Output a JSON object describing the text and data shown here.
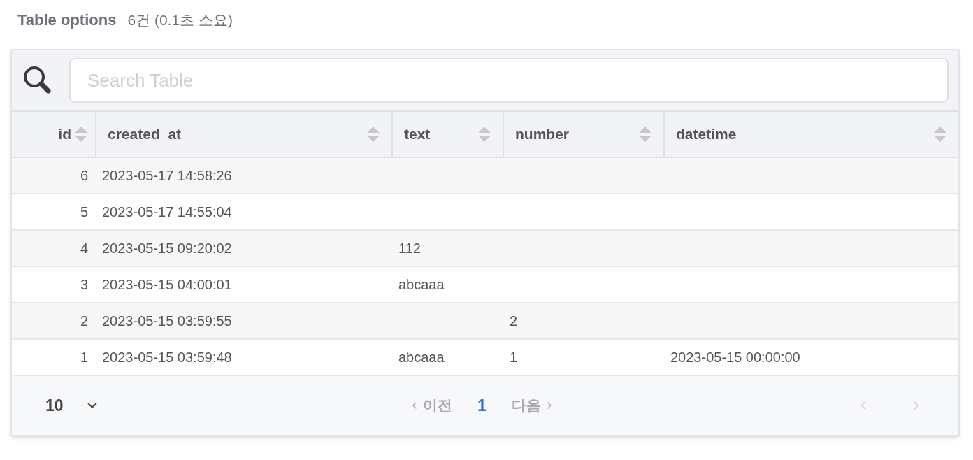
{
  "header": {
    "title": "Table options",
    "summary": "6건 (0.1초 소요)"
  },
  "search": {
    "placeholder": "Search Table"
  },
  "table": {
    "columns": [
      {
        "label": "id"
      },
      {
        "label": "created_at"
      },
      {
        "label": "text"
      },
      {
        "label": "number"
      },
      {
        "label": "datetime"
      }
    ],
    "rows": [
      {
        "cells": [
          "6",
          "2023-05-17 14:58:26",
          null,
          null,
          null
        ]
      },
      {
        "cells": [
          "5",
          "2023-05-17 14:55:04",
          null,
          null,
          null
        ]
      },
      {
        "cells": [
          "4",
          "2023-05-15 09:20:02",
          "112",
          null,
          null
        ]
      },
      {
        "cells": [
          "3",
          "2023-05-15 04:00:01",
          "abcaaa",
          null,
          null
        ]
      },
      {
        "cells": [
          "2",
          "2023-05-15 03:59:55",
          null,
          "2",
          null
        ]
      },
      {
        "cells": [
          "1",
          "2023-05-15 03:59:48",
          "abcaaa",
          "1",
          "2023-05-15 00:00:00"
        ]
      }
    ]
  },
  "pagination": {
    "page_size": "10",
    "previous": {
      "label": "이전",
      "disabled": true
    },
    "pages": [
      {
        "label": "1",
        "selected": true
      }
    ],
    "next": {
      "label": "다음",
      "disabled": true
    },
    "first_arrow_disabled": true,
    "last_arrow_disabled": true
  }
}
